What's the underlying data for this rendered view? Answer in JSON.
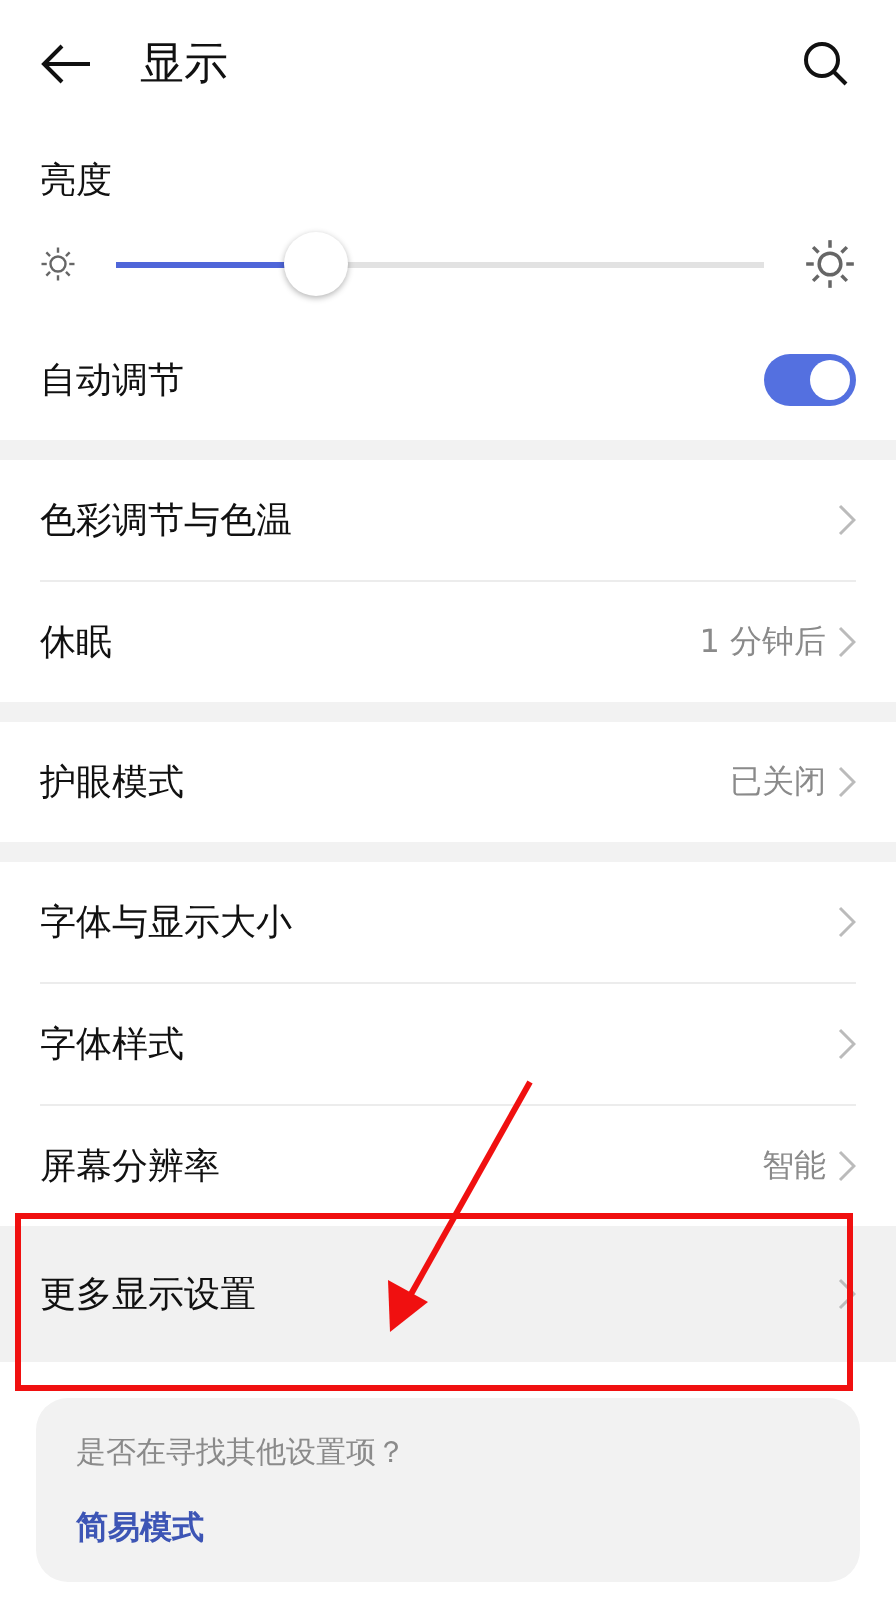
{
  "header": {
    "title": "显示"
  },
  "brightness": {
    "label": "亮度",
    "level": 0.31
  },
  "auto_adjust": {
    "label": "自动调节",
    "on": true
  },
  "groups": [
    {
      "items": [
        {
          "label": "色彩调节与色温",
          "highlighted": false
        },
        {
          "label": "休眠",
          "value": "1 分钟后",
          "highlighted": false
        }
      ]
    },
    {
      "items": [
        {
          "label": "护眼模式",
          "value": "已关闭",
          "highlighted": false
        }
      ]
    },
    {
      "items": [
        {
          "label": "字体与显示大小",
          "highlighted": false
        },
        {
          "label": "字体样式",
          "highlighted": false
        },
        {
          "label": "屏幕分辨率",
          "value": "智能",
          "highlighted": false
        },
        {
          "label": "更多显示设置",
          "highlighted": true
        }
      ]
    }
  ],
  "suggestion": {
    "question": "是否在寻找其他设置项？",
    "link": "简易模式"
  }
}
